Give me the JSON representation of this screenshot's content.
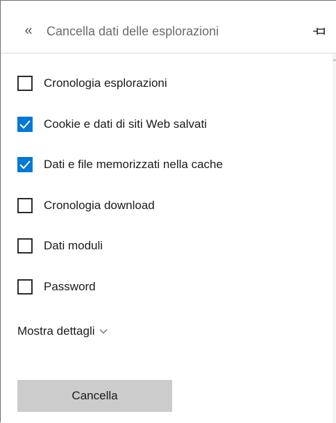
{
  "header": {
    "back_icon": "double-chevron-left-icon",
    "back_glyph": "«",
    "title": "Cancella dati delle esplorazioni",
    "pin_icon": "pin-icon"
  },
  "options": [
    {
      "label": "Cronologia esplorazioni",
      "checked": false
    },
    {
      "label": "Cookie e dati di siti Web salvati",
      "checked": true
    },
    {
      "label": "Dati e file memorizzati nella cache",
      "checked": true
    },
    {
      "label": "Cronologia download",
      "checked": false
    },
    {
      "label": "Dati moduli",
      "checked": false
    },
    {
      "label": "Password",
      "checked": false
    }
  ],
  "details": {
    "label": "Mostra dettagli",
    "icon": "chevron-down-icon"
  },
  "clear_button": {
    "label": "Cancella"
  },
  "colors": {
    "accent": "#0078d7",
    "button_bg": "#cccccc"
  }
}
